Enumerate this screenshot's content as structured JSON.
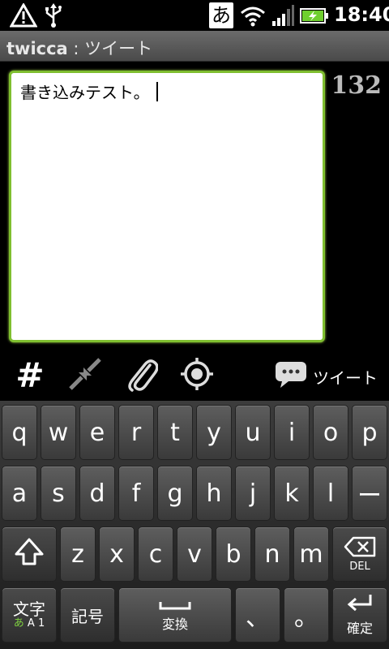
{
  "status_bar": {
    "ime_indicator": "あ",
    "time": "18:40",
    "icons": [
      "alert-triangle-icon",
      "usb-icon",
      "wifi-icon",
      "signal-bars-icon",
      "battery-charging-icon"
    ]
  },
  "title_bar": {
    "app_name": "twicca",
    "separator": " : ",
    "screen_name": "ツイート"
  },
  "compose": {
    "text": "書き込みテスト。",
    "remaining_chars": "132"
  },
  "toolbar": {
    "hashtag_glyph": "#",
    "tweet_label": "ツイート",
    "icons": [
      "hashtag-icon",
      "shrink-arrows-icon",
      "paperclip-icon",
      "location-target-icon",
      "speech-bubble-icon"
    ]
  },
  "keyboard": {
    "row1": [
      "q",
      "w",
      "e",
      "r",
      "t",
      "y",
      "u",
      "i",
      "o",
      "p"
    ],
    "row2": [
      "a",
      "s",
      "d",
      "f",
      "g",
      "h",
      "j",
      "k",
      "l",
      "ー"
    ],
    "row3": [
      "z",
      "x",
      "c",
      "v",
      "b",
      "n",
      "m"
    ],
    "del_label": "DEL",
    "mode_label_top": "文字",
    "mode_label_a": "あ",
    "mode_label_rest": "A 1",
    "symbols_label": "記号",
    "space_label": "変換",
    "comma_label": "、",
    "period_label": "。",
    "enter_label": "確定"
  },
  "colors": {
    "compose_border": "#7fbf30",
    "mode_accent": "#7fd040"
  }
}
